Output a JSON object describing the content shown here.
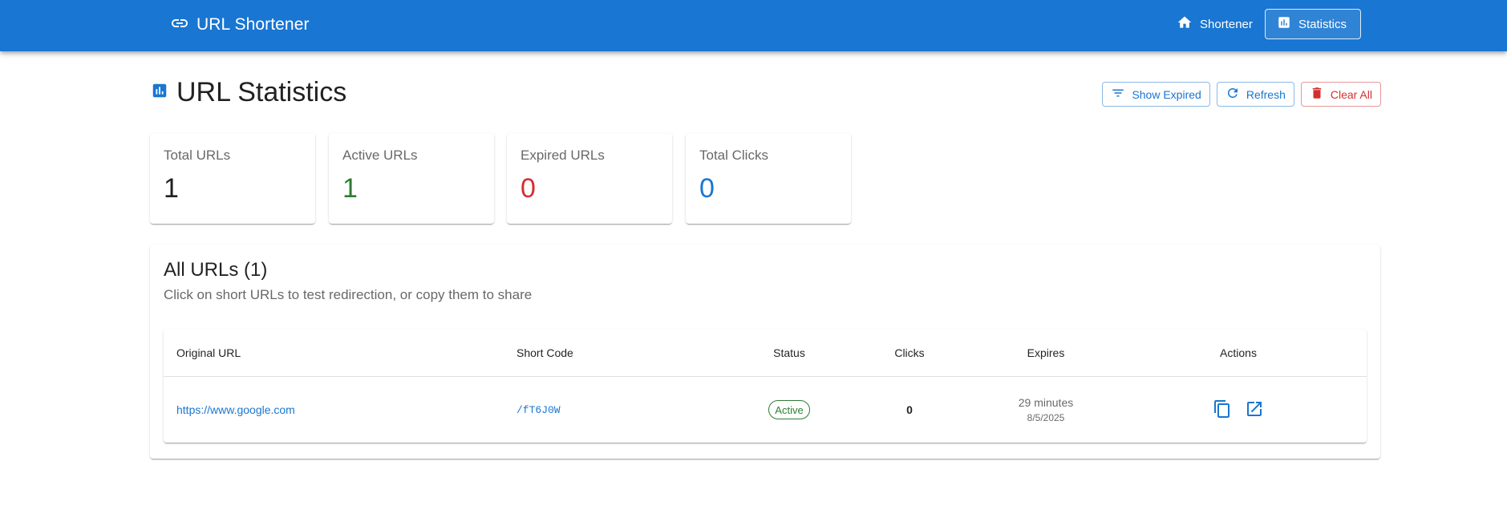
{
  "app": {
    "title": "URL Shortener",
    "nav": [
      {
        "label": "Shortener",
        "icon": "home-icon",
        "active": false
      },
      {
        "label": "Statistics",
        "icon": "bar-chart-icon",
        "active": true
      }
    ]
  },
  "page": {
    "title": "URL Statistics",
    "actions": [
      {
        "label": "Show Expired",
        "icon": "filter-icon",
        "variant": "primary"
      },
      {
        "label": "Refresh",
        "icon": "refresh-icon",
        "variant": "primary"
      },
      {
        "label": "Clear All",
        "icon": "delete-icon",
        "variant": "danger"
      }
    ]
  },
  "stats": [
    {
      "label": "Total URLs",
      "value": "1",
      "color": "#212121"
    },
    {
      "label": "Active URLs",
      "value": "1",
      "color": "#2e7d32"
    },
    {
      "label": "Expired URLs",
      "value": "0",
      "color": "#d32f2f"
    },
    {
      "label": "Total Clicks",
      "value": "0",
      "color": "#1976d2"
    }
  ],
  "table": {
    "title": "All URLs (1)",
    "subtitle": "Click on short URLs to test redirection, or copy them to share",
    "columns": [
      "Original URL",
      "Short Code",
      "Status",
      "Clicks",
      "Expires",
      "Actions"
    ],
    "rows": [
      {
        "original_url": "https://www.google.com",
        "short_code": "/fT6J0W",
        "status": "Active",
        "clicks": "0",
        "expires_relative": "29 minutes",
        "expires_date": "8/5/2025",
        "actions": [
          "copy-icon",
          "open-in-new-icon"
        ]
      }
    ]
  },
  "colors": {
    "primary": "#1976d2",
    "success": "#2e7d32",
    "error": "#d32f2f"
  }
}
